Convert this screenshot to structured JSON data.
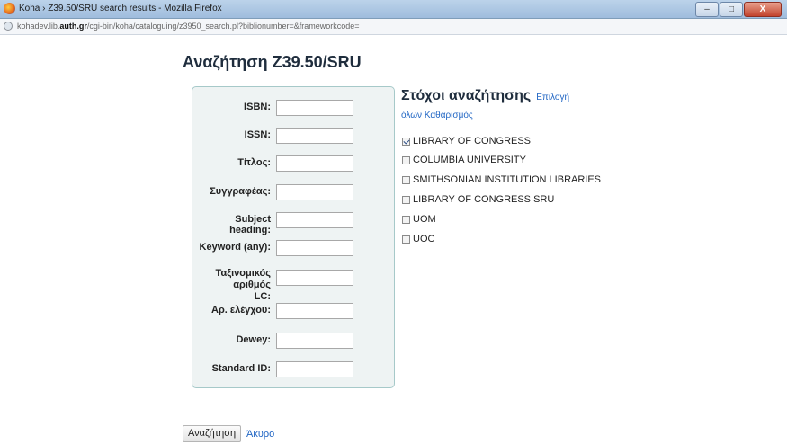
{
  "window": {
    "title": "Koha › Z39.50/SRU search results - Mozilla Firefox",
    "controls": {
      "minimize": "–",
      "maximize": "□",
      "close": "X"
    }
  },
  "address_bar": {
    "url_prefix": "kohadev.lib.",
    "url_domain": "auth.gr",
    "url_path": "/cgi-bin/koha/cataloguing/z3950_search.pl?biblionumber=&frameworkcode="
  },
  "page": {
    "title": "Αναζήτηση Z39.50/SRU"
  },
  "search_form": {
    "fields": [
      {
        "label": "ISBN:",
        "value": ""
      },
      {
        "label": "ISSN:",
        "value": ""
      },
      {
        "label": "Τίτλος:",
        "value": ""
      },
      {
        "label": "Συγγραφέας:",
        "value": ""
      },
      {
        "label": "Subject heading:",
        "value": ""
      },
      {
        "label": "Keyword (any):",
        "value": ""
      },
      {
        "label_line1": "Ταξινομικός αριθμός",
        "label_line2": "LC:",
        "value": ""
      },
      {
        "label": "Αρ. ελέγχου:",
        "value": ""
      },
      {
        "label": "Dewey:",
        "value": ""
      },
      {
        "label": "Standard ID:",
        "value": ""
      }
    ]
  },
  "targets": {
    "heading": "Στόχοι αναζήτησης",
    "select_all_line1": "Επιλογή",
    "select_all_line2": "όλων",
    "clear": "Καθαρισμός",
    "items": [
      {
        "label": "LIBRARY OF CONGRESS",
        "checked": true
      },
      {
        "label": "COLUMBIA UNIVERSITY",
        "checked": false
      },
      {
        "label": "SMITHSONIAN INSTITUTION LIBRARIES",
        "checked": false
      },
      {
        "label": "LIBRARY OF CONGRESS SRU",
        "checked": false
      },
      {
        "label": "UOM",
        "checked": false
      },
      {
        "label": "UOC",
        "checked": false
      }
    ]
  },
  "actions": {
    "search": "Αναζήτηση",
    "cancel": "Άκυρο"
  }
}
